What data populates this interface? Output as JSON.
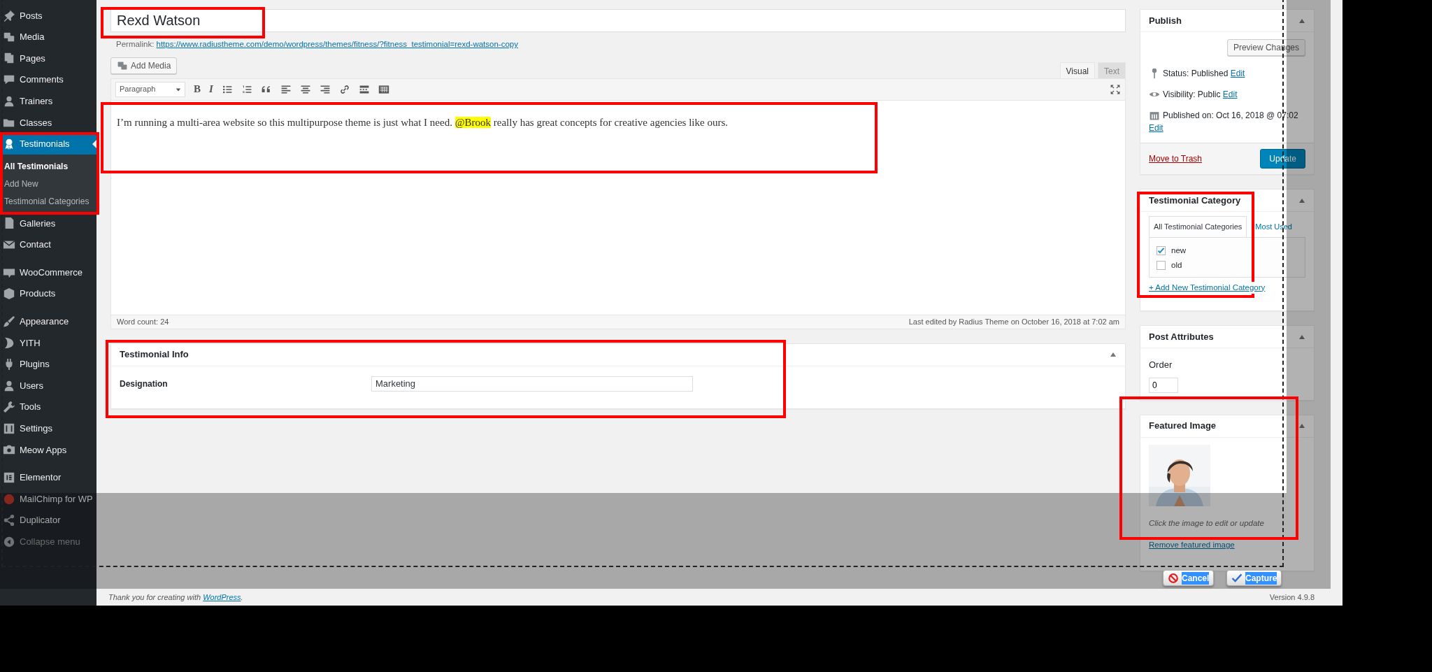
{
  "sidebar": {
    "groups": [
      [
        {
          "label": "Posts",
          "selected": false
        },
        {
          "label": "Media",
          "selected": false
        },
        {
          "label": "Pages",
          "selected": false
        },
        {
          "label": "Comments",
          "selected": false
        },
        {
          "label": "Trainers",
          "selected": false
        },
        {
          "label": "Classes",
          "selected": false
        },
        {
          "label": "Testimonials",
          "selected": true,
          "children": [
            {
              "label": "All Testimonials",
              "selected": true
            },
            {
              "label": "Add New",
              "selected": false
            },
            {
              "label": "Testimonial Categories",
              "selected": false
            }
          ]
        },
        {
          "label": "Galleries",
          "selected": false
        },
        {
          "label": "Contact",
          "selected": false
        }
      ],
      [
        {
          "label": "WooCommerce",
          "selected": false
        },
        {
          "label": "Products",
          "selected": false
        }
      ],
      [
        {
          "label": "Appearance",
          "selected": false
        },
        {
          "label": "YITH",
          "selected": false
        },
        {
          "label": "Plugins",
          "selected": false
        },
        {
          "label": "Users",
          "selected": false
        },
        {
          "label": "Tools",
          "selected": false
        },
        {
          "label": "Settings",
          "selected": false
        },
        {
          "label": "Meow Apps",
          "selected": false
        }
      ],
      [
        {
          "label": "Elementor",
          "selected": false
        },
        {
          "label": "MailChimp for WP",
          "selected": false
        },
        {
          "label": "Duplicator",
          "selected": false
        }
      ]
    ],
    "collapse_label": "Collapse menu"
  },
  "editor": {
    "title": "Rexd Watson",
    "permalink_label": "Permalink:",
    "permalink_url": "https://www.radiustheme.com/demo/wordpress/themes/fitness/?fitness_testimonial=rexd-watson-copy",
    "add_media": "Add Media",
    "tabs": [
      {
        "label": "Visual",
        "selected": true
      },
      {
        "label": "Text",
        "selected": false
      }
    ],
    "format": "Paragraph",
    "toolbar": [
      {
        "kind": "text",
        "label": "B"
      },
      {
        "kind": "text",
        "label": "I"
      },
      {
        "kind": "bullets"
      },
      {
        "kind": "numbers"
      },
      {
        "kind": "quote"
      },
      {
        "kind": "align-left"
      },
      {
        "kind": "align-center"
      },
      {
        "kind": "align-right"
      },
      {
        "kind": "link"
      },
      {
        "kind": "more"
      },
      {
        "kind": "grid"
      }
    ],
    "content": [
      {
        "text": "I’m running a multi-area website so this multipurpose theme is just what I need. ",
        "highlighted": false
      },
      {
        "text": "@Brook",
        "highlighted": true
      },
      {
        "text": " really has great concepts for creative agencies like ours.",
        "highlighted": false
      }
    ],
    "word_count": "Word count: 24",
    "last_edited": "Last edited by Radius Theme on October 16, 2018 at 7:02 am"
  },
  "testimonial_info": {
    "title": "Testimonial Info",
    "fields": [
      {
        "label": "Designation",
        "value": "Marketing"
      }
    ]
  },
  "publish": {
    "title": "Publish",
    "preview": "Preview Changes",
    "rows": [
      {
        "kind": "status",
        "text": "Status: Published",
        "link": "Edit"
      },
      {
        "kind": "visibility",
        "text": "Visibility: Public",
        "link": "Edit"
      },
      {
        "kind": "date",
        "text": "Published on: Oct 16, 2018 @ 07:02",
        "link": "Edit"
      }
    ],
    "trash": "Move to Trash",
    "update": "Update"
  },
  "category": {
    "title": "Testimonial Category",
    "tabs": [
      {
        "label": "All Testimonial Categories",
        "selected": true
      },
      {
        "label": "Most Used",
        "selected": false
      }
    ],
    "items": [
      {
        "label": "new",
        "checked": true
      },
      {
        "label": "old",
        "checked": false
      }
    ],
    "add_link": "+ Add New Testimonial Category"
  },
  "attributes": {
    "title": "Post Attributes",
    "order_label": "Order",
    "order_value": "0"
  },
  "featured": {
    "title": "Featured Image",
    "hint": "Click the image to edit or update",
    "remove": "Remove featured image"
  },
  "capture": {
    "cancel": "Cancel",
    "capture": "Capture"
  },
  "footer": {
    "text": "Thank you for creating with ",
    "link": "WordPress",
    "after": ".",
    "version": "Version 4.9.8"
  }
}
